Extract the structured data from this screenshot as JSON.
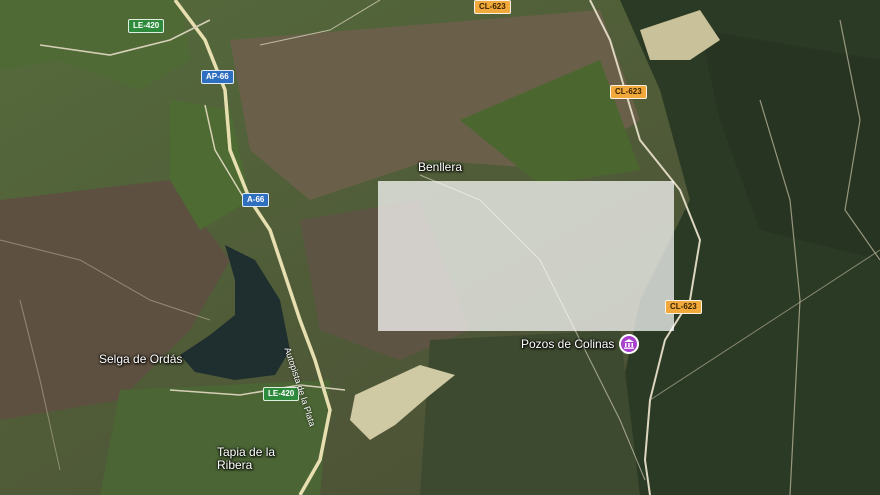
{
  "map": {
    "places": {
      "benllera": "Benllera",
      "selga": "Selga de Ordás",
      "tapia": "Tapia de la Ribera"
    },
    "poi": {
      "name": "Pozos de Colinas",
      "icon": "museum-icon",
      "color": "#a83fcf"
    },
    "roads": {
      "le420_top": "LE-420",
      "le420_bottom": "LE-420",
      "ap66": "AP-66",
      "a66": "A-66",
      "cl623_top": "CL-623",
      "cl623_mid": "CL-623",
      "cl623_bottom": "CL-623",
      "motorway_name": "Autopista de la Plata"
    },
    "colors": {
      "highlight": "#ffffff",
      "shield_green": "#2e8b3c",
      "shield_blue": "#2f6fbf",
      "shield_orange": "#f2a93b"
    }
  }
}
